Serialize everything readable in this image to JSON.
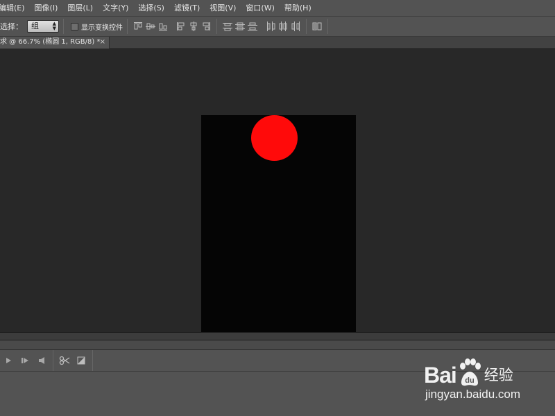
{
  "menu": {
    "items": [
      {
        "label": "编辑(E)"
      },
      {
        "label": "图像(I)"
      },
      {
        "label": "图层(L)"
      },
      {
        "label": "文字(Y)"
      },
      {
        "label": "选择(S)"
      },
      {
        "label": "滤镜(T)"
      },
      {
        "label": "视图(V)"
      },
      {
        "label": "窗口(W)"
      },
      {
        "label": "帮助(H)"
      }
    ]
  },
  "options": {
    "select_label": "选择：",
    "select_value": "组",
    "show_transform_label": "显示变换控件",
    "show_transform_checked": false
  },
  "document": {
    "tab_label": "求 @ 66.7% (椭圆 1, RGB/8) *",
    "close_glyph": "×",
    "canvas_color": "#050505",
    "shape_color": "#ff0a0a"
  },
  "watermark": {
    "logo_left": "Bai",
    "logo_right": "du",
    "logo_suffix": "经验",
    "url": "jingyan.baidu.com"
  }
}
